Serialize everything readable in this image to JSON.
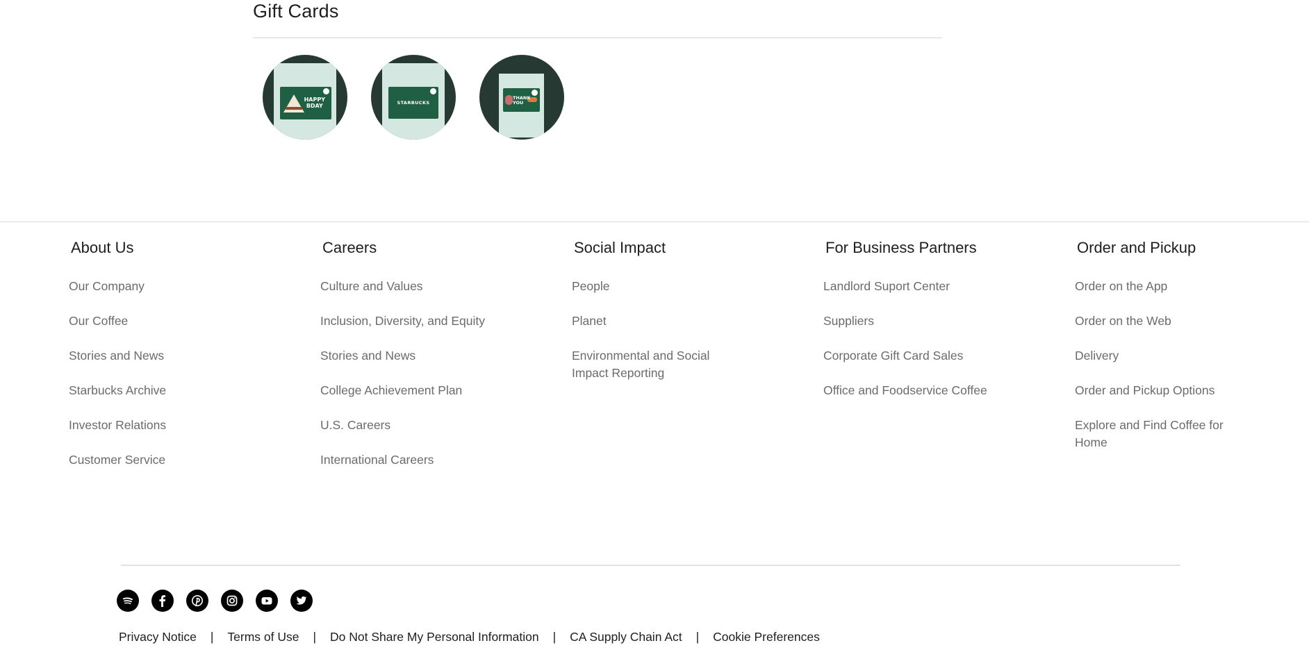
{
  "gift_cards": {
    "title": "Gift Cards",
    "cards": [
      {
        "face_text": "HAPPY BDAY",
        "name": "happy-bday"
      },
      {
        "face_text": "STARBUCKS",
        "name": "starbucks"
      },
      {
        "face_text": "THANK YOU",
        "name": "thank-you"
      }
    ]
  },
  "footer": {
    "columns": [
      {
        "heading": "About Us",
        "links": [
          "Our Company",
          "Our Coffee",
          "Stories and News",
          "Starbucks Archive",
          "Investor Relations",
          "Customer Service"
        ]
      },
      {
        "heading": "Careers",
        "links": [
          "Culture and Values",
          "Inclusion, Diversity, and Equity",
          "Stories and News",
          "College Achievement Plan",
          "U.S. Careers",
          "International Careers"
        ]
      },
      {
        "heading": "Social Impact",
        "links": [
          "People",
          "Planet",
          "Environmental and Social Impact Reporting"
        ]
      },
      {
        "heading": "For Business Partners",
        "links": [
          "Landlord Suport Center",
          "Suppliers",
          "Corporate Gift Card Sales",
          "Office and Foodservice Coffee"
        ]
      },
      {
        "heading": "Order and Pickup",
        "links": [
          "Order on the App",
          "Order on the Web",
          "Delivery",
          "Order and Pickup Options",
          "Explore and Find Coffee for Home"
        ]
      }
    ],
    "social_icons": [
      "spotify-icon",
      "facebook-icon",
      "pinterest-icon",
      "instagram-icon",
      "youtube-icon",
      "twitter-icon"
    ],
    "legal_links": [
      "Privacy Notice",
      "Terms of Use",
      "Do Not Share My Personal Information",
      "CA Supply Chain Act",
      "Cookie Preferences"
    ],
    "legal_separator": "|"
  },
  "colors": {
    "card_circle": "#263933",
    "card_paper": "#d4e7e1",
    "card_face": "#1f6045",
    "link_gray": "#6b6b6b",
    "heading": "#1e1e1e"
  }
}
